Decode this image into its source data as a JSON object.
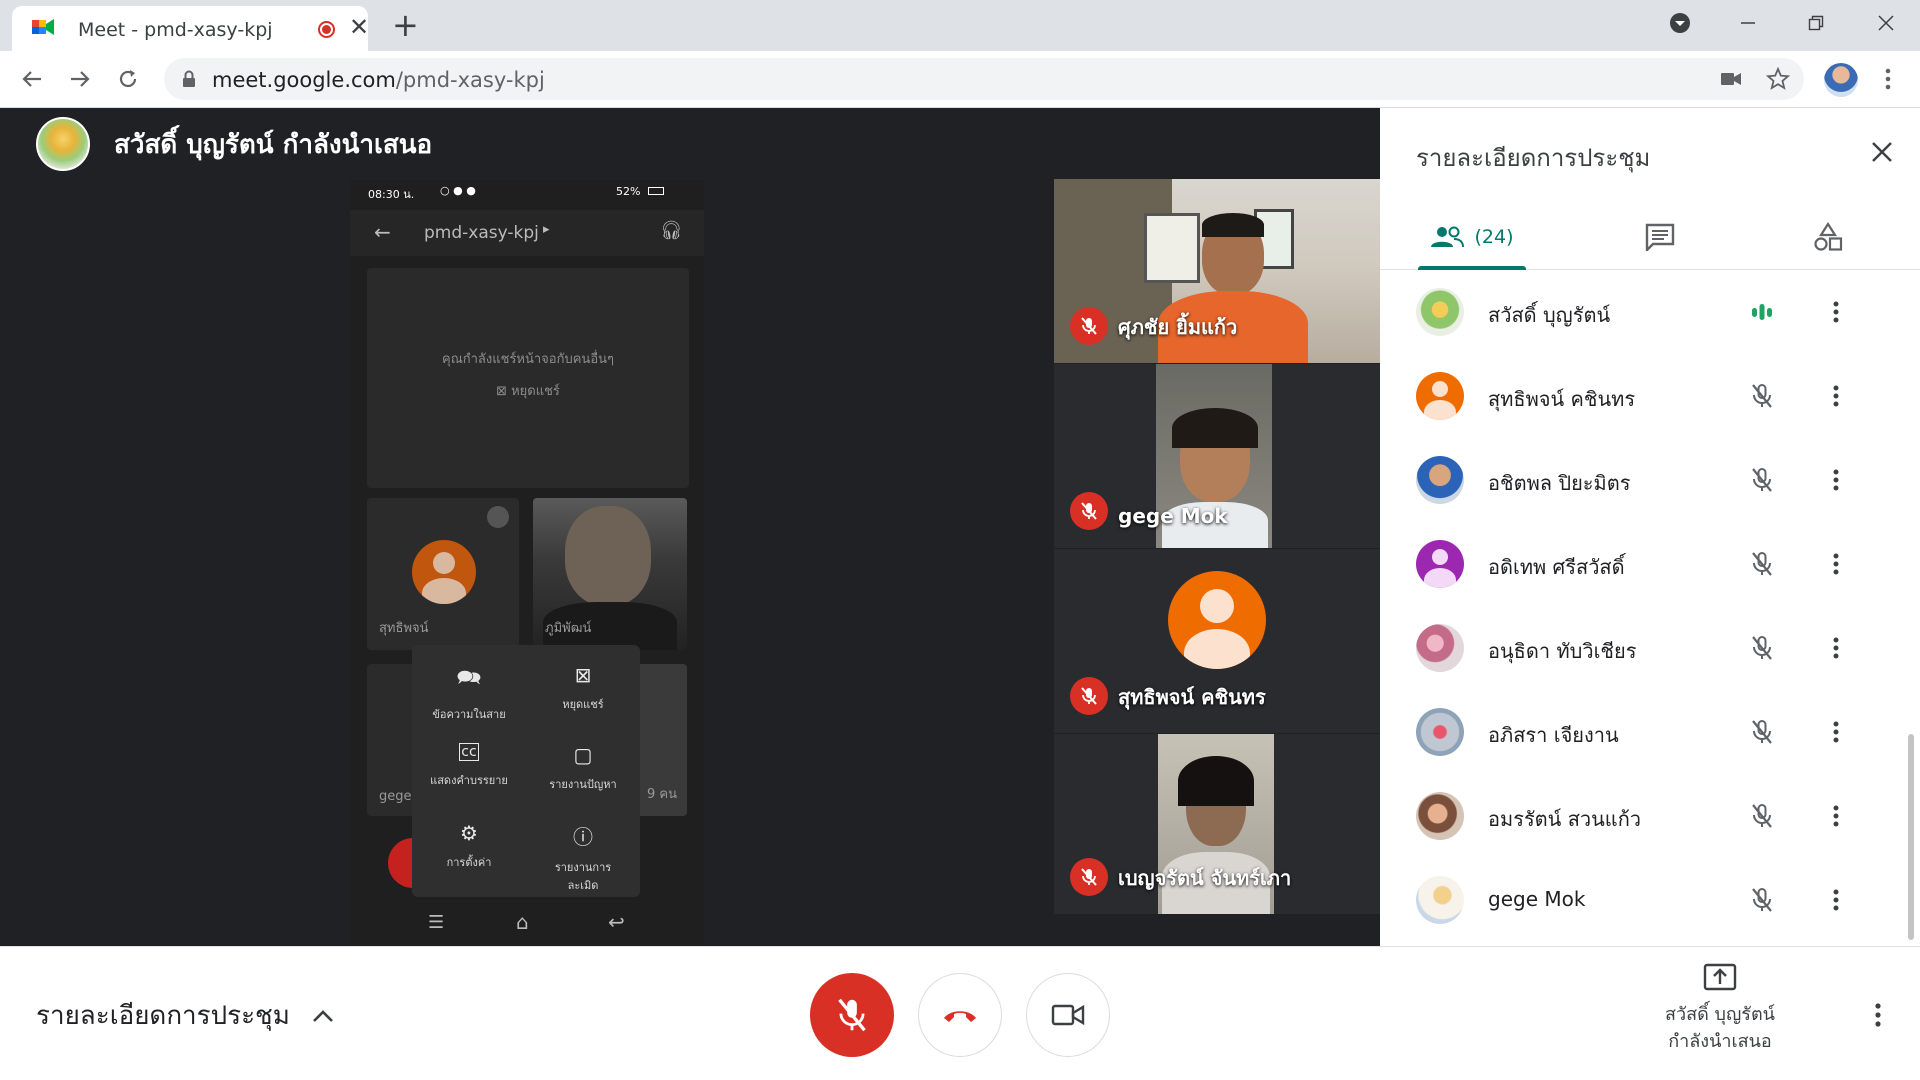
{
  "browser": {
    "tab_title": "Meet - pmd-xasy-kpj",
    "url_host": "meet.google.com",
    "url_path": "/pmd-xasy-kpj"
  },
  "stage": {
    "presenter_banner": "สวัสดิ์ บุญรัตน์ กำลังนำเสนอ"
  },
  "phone": {
    "status_time": "08:30 น.",
    "status_battery": "52%",
    "meeting_code": "pmd-xasy-kpj",
    "share_message": "คุณกำลังแชร์หน้าจอกับคนอื่นๆ",
    "stop_share": "หยุดแชร์",
    "tile1_name": "สุทธิพจน์",
    "tile2_name": "ภูมิพัฒน์",
    "tile3_name": "gege",
    "tile4_name": "9 คน",
    "menu": {
      "chat": "ข้อความในสาย",
      "stop_share": "หยุดแชร์",
      "captions": "แสดงคำบรรยาย",
      "report_problem": "รายงานปัญหา",
      "settings": "การตั้งค่า",
      "report_abuse_1": "รายงานการ",
      "report_abuse_2": "ละเมิด"
    }
  },
  "videos": [
    {
      "name": "ศุภชัย ยิ้มแก้ว"
    },
    {
      "name": "gege Mok"
    },
    {
      "name": "สุทธิพจน์ คชินทร"
    },
    {
      "name": "เบญจรัตน์ จันทร์เภา"
    }
  ],
  "panel": {
    "title": "รายละเอียดการประชุม",
    "people_count": "(24)",
    "participants": [
      {
        "name": "สวัสดิ์ บุญรัตน์",
        "speaking": true
      },
      {
        "name": "สุทธิพจน์ คชินทร",
        "speaking": false
      },
      {
        "name": "อชิตพล ปิยะมิตร",
        "speaking": false
      },
      {
        "name": "อดิเทพ ศรีสวัสดิ์",
        "speaking": false
      },
      {
        "name": "อนุธิดา ทับวิเชียร",
        "speaking": false
      },
      {
        "name": "อภิสรา เจียงาน",
        "speaking": false
      },
      {
        "name": "อมรรัตน์ สวนแก้ว",
        "speaking": false
      },
      {
        "name": "gege Mok",
        "speaking": false
      }
    ]
  },
  "bottom": {
    "details_label": "รายละเอียดการประชุม",
    "presenting_line1": "สวัสดิ์ บุญรัตน์",
    "presenting_line2": "กำลังนำเสนอ"
  },
  "colors": {
    "accent": "#00796b",
    "danger": "#d93025",
    "stage_bg": "#202124"
  }
}
